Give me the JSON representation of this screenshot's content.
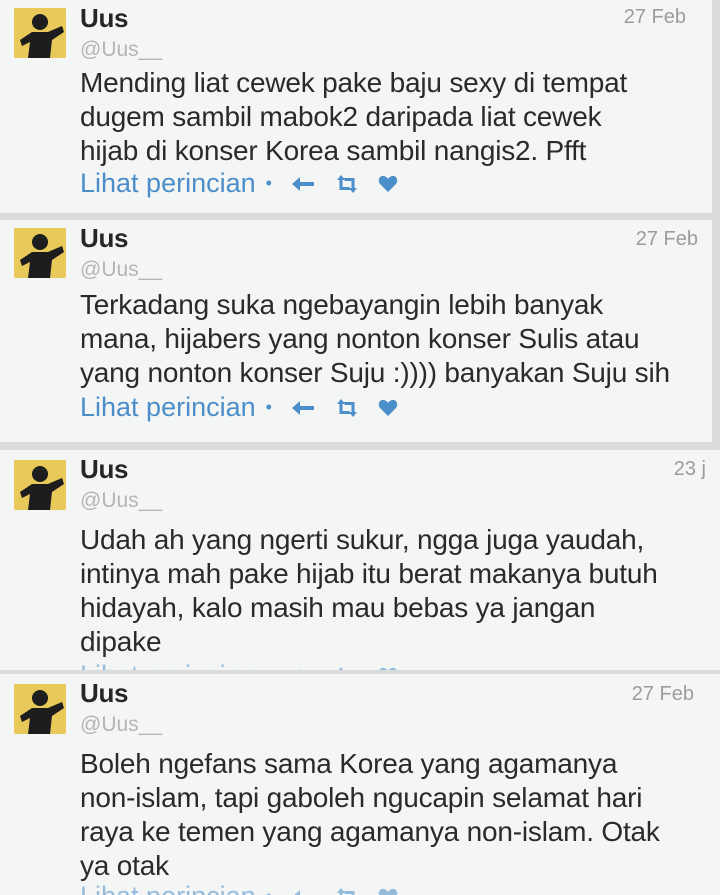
{
  "tweets": [
    {
      "name": "Uus",
      "handle": "@Uus__",
      "date": "27 Feb",
      "body": "Mending liat cewek pake baju sexy di tempat\ndugem sambil mabok2 daripada liat cewek\nhijab di konser Korea sambil nangis2. Pfft",
      "details": "Lihat perincian",
      "separator": "•"
    },
    {
      "name": "Uus",
      "handle": "@Uus__",
      "date": "27 Feb",
      "body": "Terkadang suka ngebayangin lebih banyak\nmana, hijabers yang nonton konser Sulis atau\nyang nonton konser Suju :)))) banyakan Suju sih",
      "details": "Lihat perincian",
      "separator": "•"
    },
    {
      "name": "Uus",
      "handle": "@Uus__",
      "date": "23 j",
      "body": "Udah ah yang ngerti sukur, ngga juga yaudah,\nintinya mah pake hijab itu berat makanya butuh\nhidayah, kalo masih mau bebas ya jangan\ndipake",
      "details": "Lihat perincian",
      "separator": "•"
    },
    {
      "name": "Uus",
      "handle": "@Uus__",
      "date": "27 Feb",
      "body": "Boleh ngefans sama Korea yang agamanya\nnon-islam, tapi gaboleh ngucapin selamat hari\nraya ke temen yang agamanya non-islam. Otak\nya otak",
      "details": "Lihat perincian",
      "separator": "•"
    }
  ],
  "colors": {
    "link": "#4b8ec9",
    "text": "#2a2a2a",
    "muted": "#9a9c9e",
    "card": "#f4f5f5",
    "avatar_bg": "#e9c95a"
  },
  "icons": [
    "reply-icon",
    "retweet-icon",
    "favorite-icon"
  ]
}
